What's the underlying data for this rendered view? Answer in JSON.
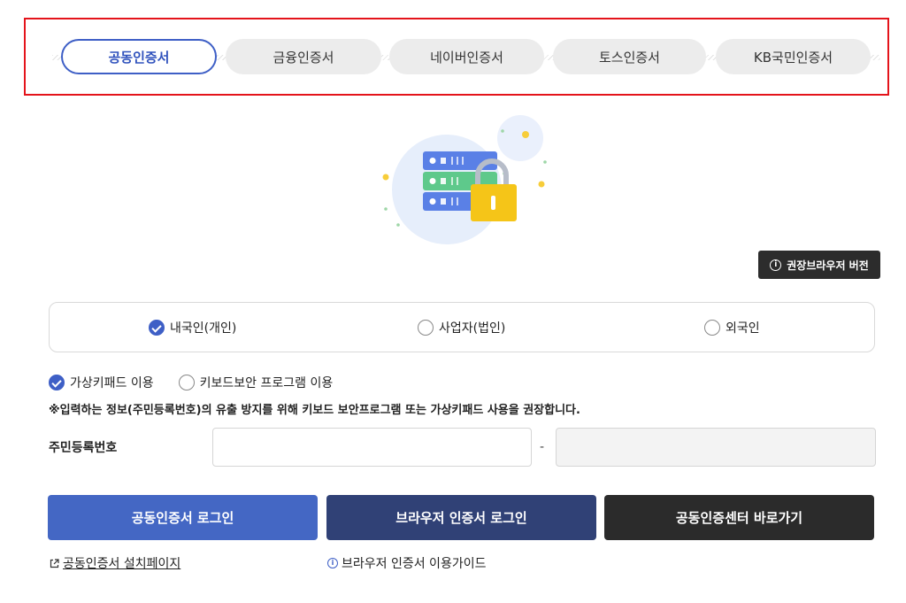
{
  "tabs": [
    {
      "label": "공동인증서",
      "active": true
    },
    {
      "label": "금융인증서",
      "active": false
    },
    {
      "label": "네이버인증서",
      "active": false
    },
    {
      "label": "토스인증서",
      "active": false
    },
    {
      "label": "KB국민인증서",
      "active": false
    }
  ],
  "badge": {
    "icon": "info-icon",
    "label": "권장브라우저 버전"
  },
  "user_type": {
    "options": [
      {
        "label": "내국인(개인)",
        "selected": true
      },
      {
        "label": "사업자(법인)",
        "selected": false
      },
      {
        "label": "외국인",
        "selected": false
      }
    ]
  },
  "input_method": {
    "options": [
      {
        "label": "가상키패드 이용",
        "selected": true
      },
      {
        "label": "키보드보안 프로그램 이용",
        "selected": false
      }
    ],
    "notice": "※입력하는 정보(주민등록번호)의 유출 방지를 위해 키보드 보안프로그램 또는 가상키패드 사용을 권장합니다."
  },
  "rrn": {
    "label": "주민등록번호",
    "separator": "-",
    "front_value": "",
    "back_value": ""
  },
  "buttons": {
    "cert_login": "공동인증서 로그인",
    "browser_login": "브라우저 인증서 로그인",
    "center": "공동인증센터 바로가기"
  },
  "links": {
    "install": "공동인증서 설치페이지",
    "guide": "브라우저 인증서 이용가이드"
  },
  "colors": {
    "accent": "#3e5fc6",
    "highlight_border": "#e4141b",
    "dark": "#2b2b2b",
    "navy": "#304176"
  }
}
